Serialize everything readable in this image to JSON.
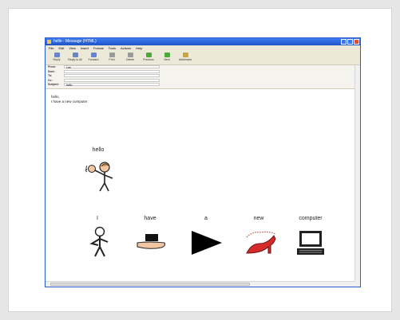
{
  "window": {
    "title": "hello - Message (HTML)"
  },
  "menu": [
    "File",
    "Edit",
    "View",
    "Insert",
    "Format",
    "Tools",
    "Actions",
    "Help"
  ],
  "toolbar": [
    {
      "label": "Reply",
      "icon": "reply-icon",
      "color": "#6b83c7"
    },
    {
      "label": "Reply to All",
      "icon": "reply-all-icon",
      "color": "#6b83c7"
    },
    {
      "label": "Forward",
      "icon": "forward-icon",
      "color": "#6b83c7"
    },
    {
      "label": "Print",
      "icon": "print-icon",
      "color": "#9a9a9a"
    },
    {
      "label": "Delete",
      "icon": "delete-icon",
      "color": "#9a9a9a"
    },
    {
      "label": "Previous",
      "icon": "previous-icon",
      "color": "#4caa3b"
    },
    {
      "label": "Next",
      "icon": "next-icon",
      "color": "#4caa3b"
    },
    {
      "label": "Addresses",
      "icon": "address-book-icon",
      "color": "#c9a640"
    }
  ],
  "headers": [
    {
      "label": "From:",
      "value": "Lee"
    },
    {
      "label": "Sent:",
      "value": ""
    },
    {
      "label": "To:",
      "value": ""
    },
    {
      "label": "Cc:",
      "value": ""
    },
    {
      "label": "Subject:",
      "value": "hello"
    }
  ],
  "body": {
    "line1": "hello,",
    "line2": "I have a new computer"
  },
  "symbols": {
    "hello": "hello",
    "i": "I",
    "have": "have",
    "a": "a",
    "new": "new",
    "computer": "computer"
  }
}
